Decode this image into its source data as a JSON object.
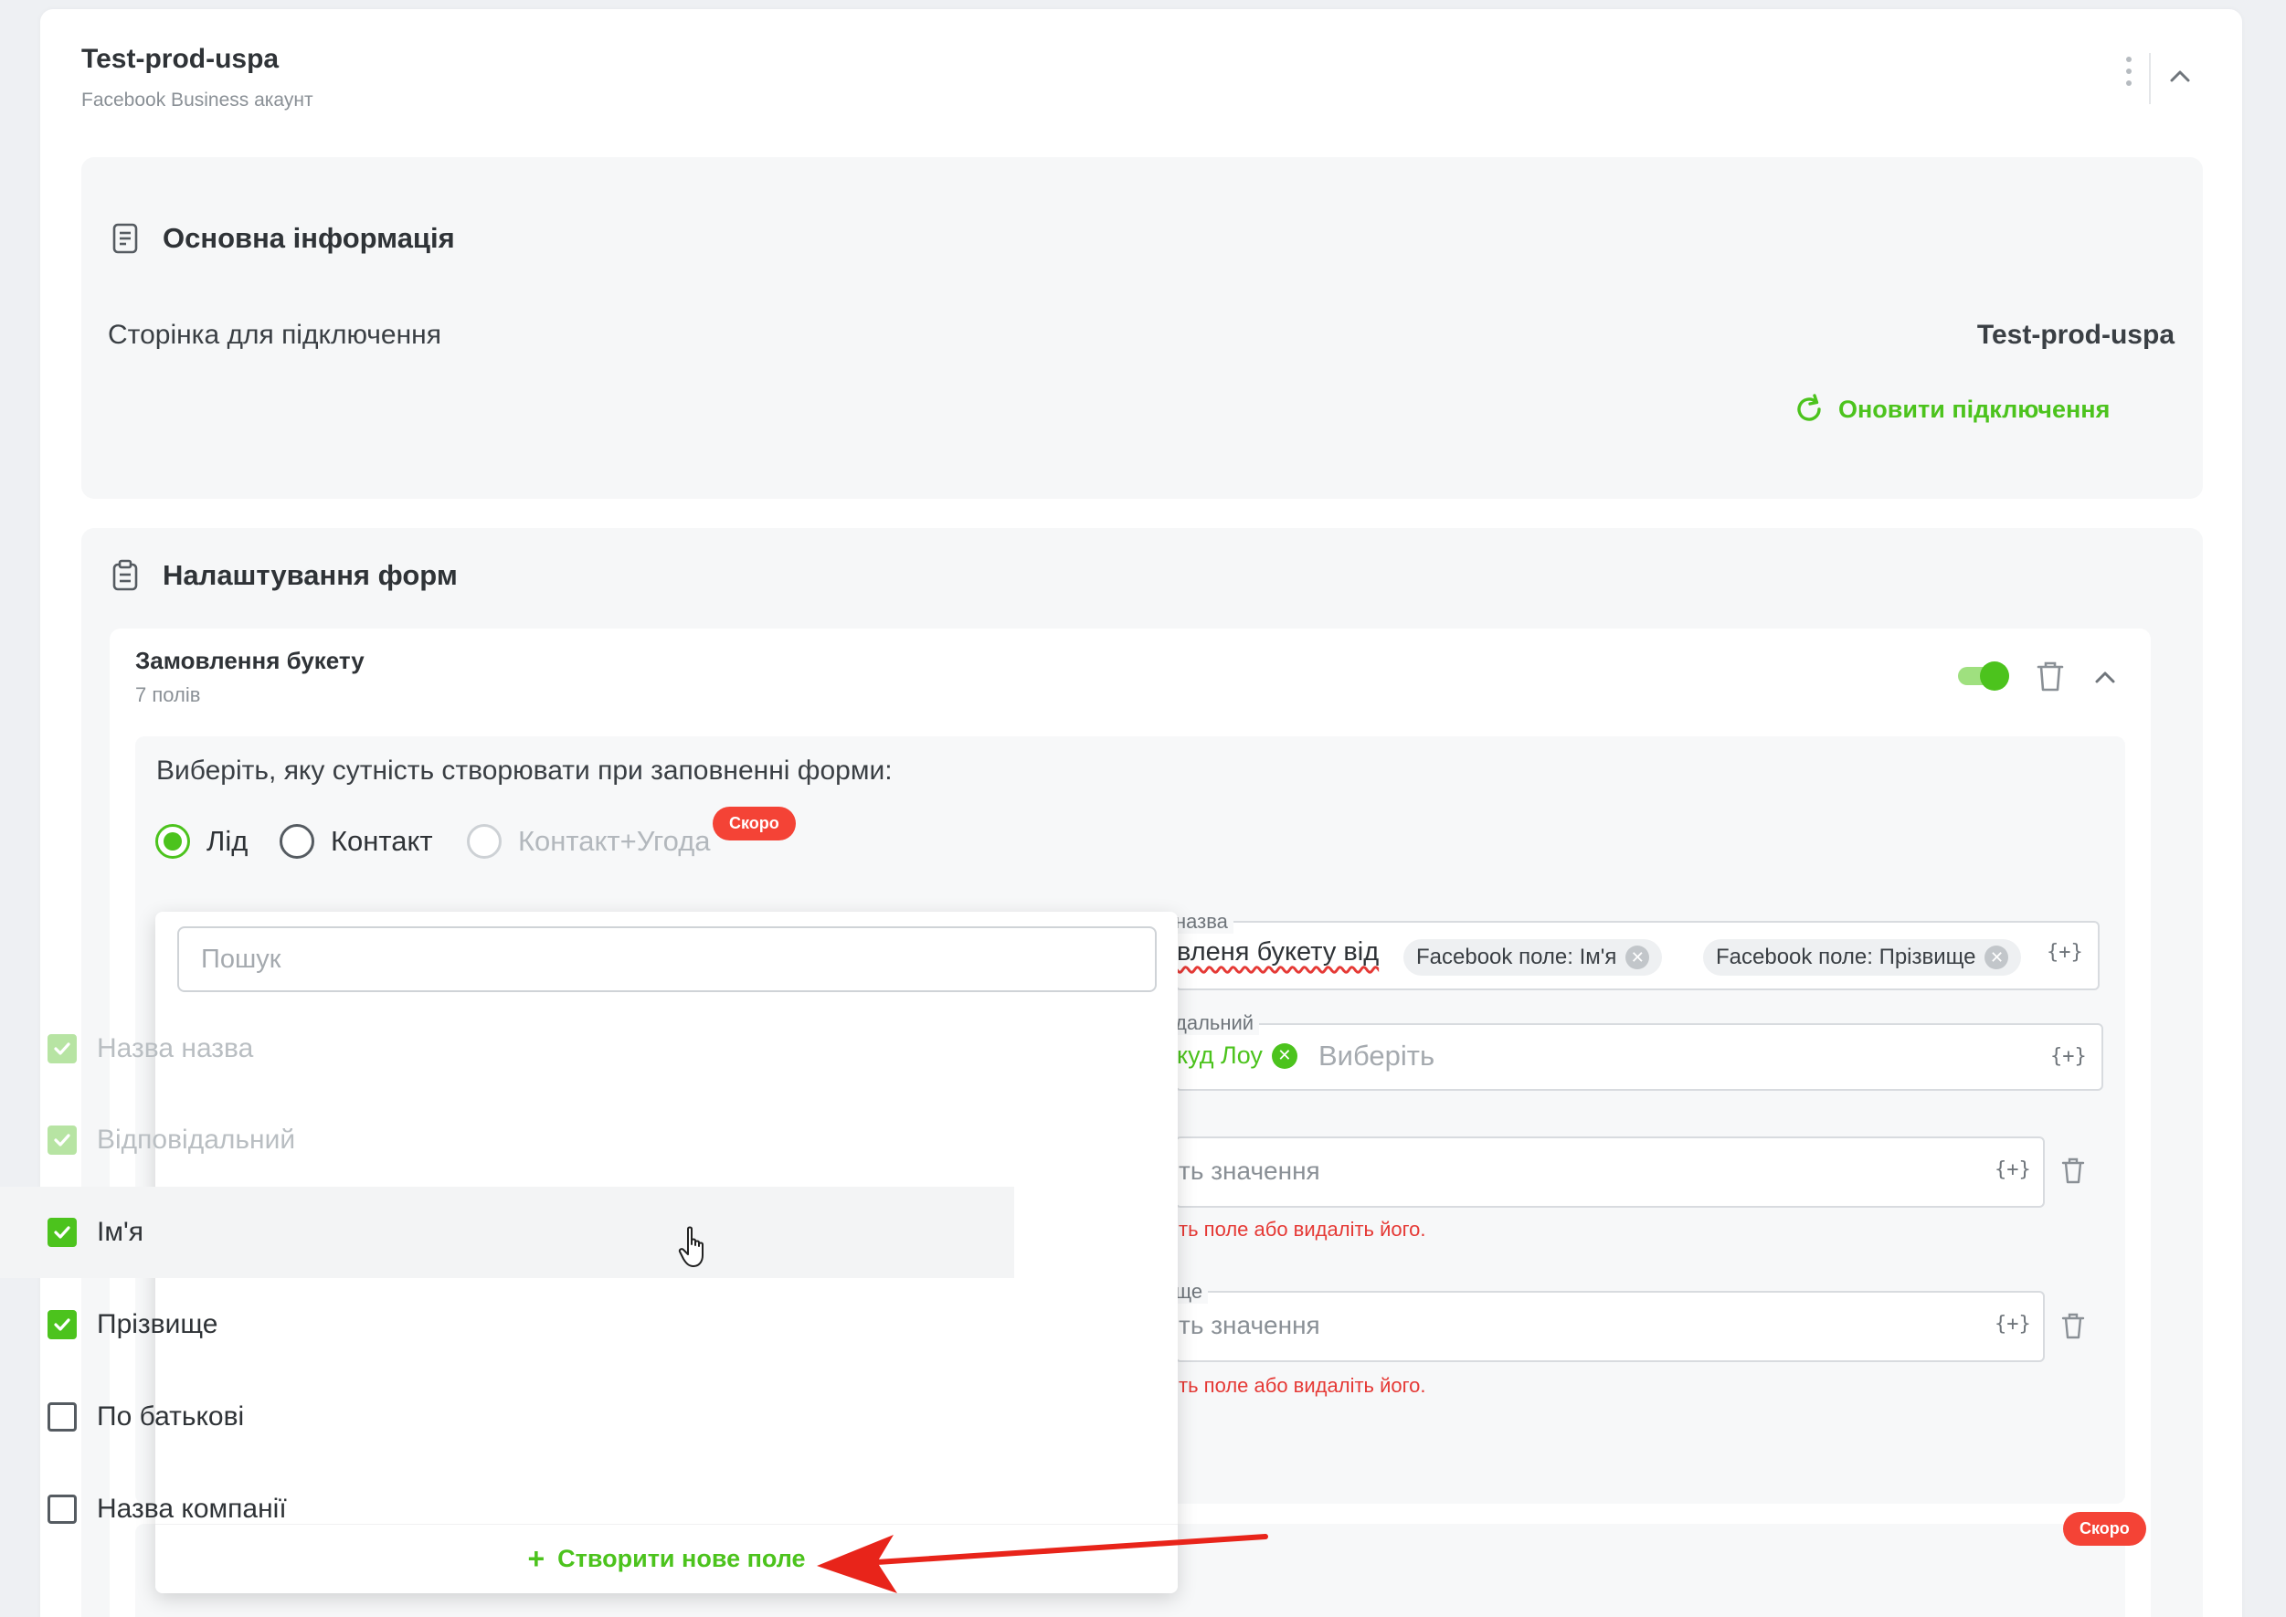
{
  "account": {
    "title": "Test-prod-uspa",
    "subtitle": "Facebook Business акаунт"
  },
  "basic_info": {
    "title": "Основна інформація",
    "connection_label": "Сторінка для підключення",
    "connection_value": "Test-prod-uspa",
    "refresh_label": "Оновити підключення"
  },
  "forms_settings": {
    "title": "Налаштування форм",
    "form": {
      "name": "Замовлення букету",
      "field_count": "7 полів",
      "enabled": true,
      "entity_question": "Виберіть, яку сутність створювати при заповненні форми:",
      "entity_options": [
        {
          "label": "Лід",
          "selected": true,
          "disabled": false
        },
        {
          "label": "Контакт",
          "selected": false,
          "disabled": false
        },
        {
          "label": "Контакт+Угода",
          "selected": false,
          "disabled": true
        }
      ],
      "soon_badge": "Скоро",
      "fields": {
        "name_label": "назва",
        "name_text": "вленя букету від",
        "name_chips": [
          "Facebook поле: Ім'я",
          "Facebook поле: Прізвище"
        ],
        "responsible_label": "дальний",
        "responsible_user": "куд Лоу",
        "responsible_placeholder": "Виберіть",
        "value_placeholder": "ть значення",
        "error_text": "ть поле або видаліть його.",
        "surname_label": "ще",
        "var_button": "{+}"
      },
      "soon_badge_2": "Скоро"
    }
  },
  "dropdown": {
    "search_placeholder": "Пошук",
    "options": [
      {
        "label": "Назва назва",
        "checked": true,
        "disabled": true
      },
      {
        "label": "Відповідальний",
        "checked": true,
        "disabled": true
      },
      {
        "label": "Ім'я",
        "checked": true,
        "disabled": false,
        "hovered": true
      },
      {
        "label": "Прізвище",
        "checked": true,
        "disabled": false
      },
      {
        "label": "По батькові",
        "checked": false,
        "disabled": false
      },
      {
        "label": "Назва компанії",
        "checked": false,
        "disabled": false
      }
    ],
    "create_label": "Створити нове поле"
  },
  "colors": {
    "accent": "#4cc31d",
    "danger": "#f44336",
    "arrow": "#e8241a"
  },
  "icons": {
    "kebab": "more-vertical-icon",
    "collapse": "chevron-up-icon",
    "section_info": "document-icon",
    "section_forms": "clipboard-icon",
    "refresh": "refresh-icon",
    "trash": "trash-icon",
    "plus": "plus-icon",
    "check": "check-icon",
    "clear": "close-circle-icon",
    "pointer": "hand-pointer-icon",
    "annotation": "red-arrow"
  }
}
